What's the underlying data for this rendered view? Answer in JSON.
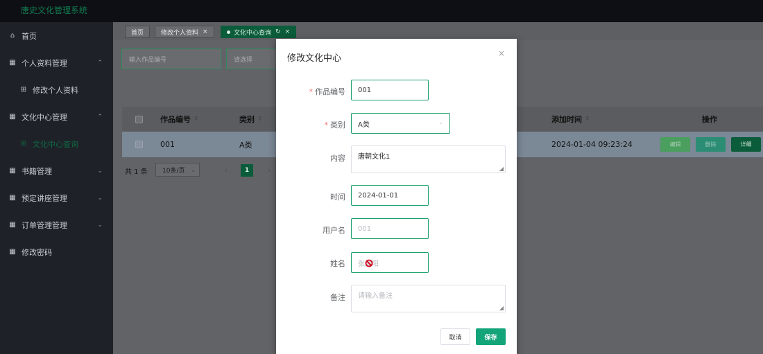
{
  "app": {
    "title": "唐史文化管理系统"
  },
  "sidebar": {
    "items": [
      {
        "label": "首页",
        "icon": "home-icon"
      },
      {
        "label": "个人资料管理",
        "icon": "menu-icon",
        "expanded": true
      },
      {
        "label": "修改个人资料",
        "icon": "grid-icon"
      },
      {
        "label": "文化中心管理",
        "icon": "menu-icon",
        "expanded": true
      },
      {
        "label": "文化中心查询",
        "icon": "grid-icon",
        "active": true
      },
      {
        "label": "书籍管理",
        "icon": "menu-icon"
      },
      {
        "label": "预定讲座管理",
        "icon": "menu-icon"
      },
      {
        "label": "订单管理管理",
        "icon": "menu-icon"
      },
      {
        "label": "修改密码",
        "icon": "menu-icon"
      }
    ]
  },
  "tabs": [
    {
      "label": "首页"
    },
    {
      "label": "修改个人资料"
    },
    {
      "label": "文化中心查询",
      "active": true
    }
  ],
  "filters": {
    "work_no_placeholder": "输入作品编号",
    "type_placeholder": "请选择"
  },
  "table": {
    "headers": {
      "work_no": "作品编号",
      "type": "类别",
      "added": "添加时间",
      "ops": "操作"
    },
    "rows": [
      {
        "work_no": "001",
        "type": "A类",
        "added": "2024-01-04 09:23:24"
      }
    ],
    "actions": {
      "edit": "编辑",
      "delete": "删除",
      "detail": "详细"
    }
  },
  "pagination": {
    "total": "共 1 条",
    "page_size": "10条/页",
    "current": "1"
  },
  "modal": {
    "title": "修改文化中心",
    "fields": {
      "work_no": {
        "label": "作品编号",
        "value": "001",
        "required": true
      },
      "type": {
        "label": "类别",
        "value": "A类",
        "required": true
      },
      "content": {
        "label": "内容",
        "value": "唐朝文化1"
      },
      "time": {
        "label": "时间",
        "value": "2024-01-01"
      },
      "username": {
        "label": "用户名",
        "value": "001"
      },
      "name": {
        "label": "姓名",
        "value": "张晨阳"
      },
      "remark": {
        "label": "备注",
        "placeholder": "请输入备注"
      }
    },
    "cancel": "取消",
    "save": "保存"
  },
  "colors": {
    "brand": "#0b5c3a",
    "accent": "#14a47a",
    "required": "#f56c6c"
  }
}
